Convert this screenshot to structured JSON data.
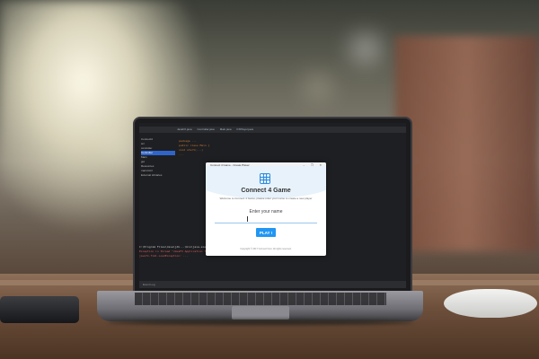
{
  "ide": {
    "tabs": [
      "JavaFX.java",
      "Controller.java",
      "Main.java",
      "FXPlayer.java"
    ],
    "tree": [
      "Connect4",
      "src",
      "controller",
      "Controller",
      "Main",
      "gui",
      "Resources",
      "main.fxml",
      "External Libraries"
    ],
    "tree_selected_index": 3,
    "code": [
      "package ...",
      "public class Main {",
      "  void start(...)",
      "  ..."
    ],
    "console": [
      {
        "text": "C:\\Program Files\\Java\\jdk...\\bin\\java.exe ...",
        "error": false
      },
      {
        "text": "Exception in thread \"JavaFX Application Thread\"",
        "error": true
      },
      {
        "text": "javafx.fxml.LoadException: ...",
        "error": true
      }
    ],
    "status": "Event Log"
  },
  "dialog": {
    "title": "Connect 4 Game - Create Player",
    "window_controls": "–  ❐  ✕",
    "heading": "Connect 4 Game",
    "subtitle": "Welcome to Connect 4 Game, please enter your name to create a new player",
    "name_label": "Enter your name",
    "name_value": "",
    "play_label": "PLAY !",
    "footer": "Copyright © 2017 Connect Four. All rights reserved."
  },
  "colors": {
    "accent": "#2196f3",
    "ide_bg": "#1e1f22",
    "error": "#e25b5b"
  }
}
